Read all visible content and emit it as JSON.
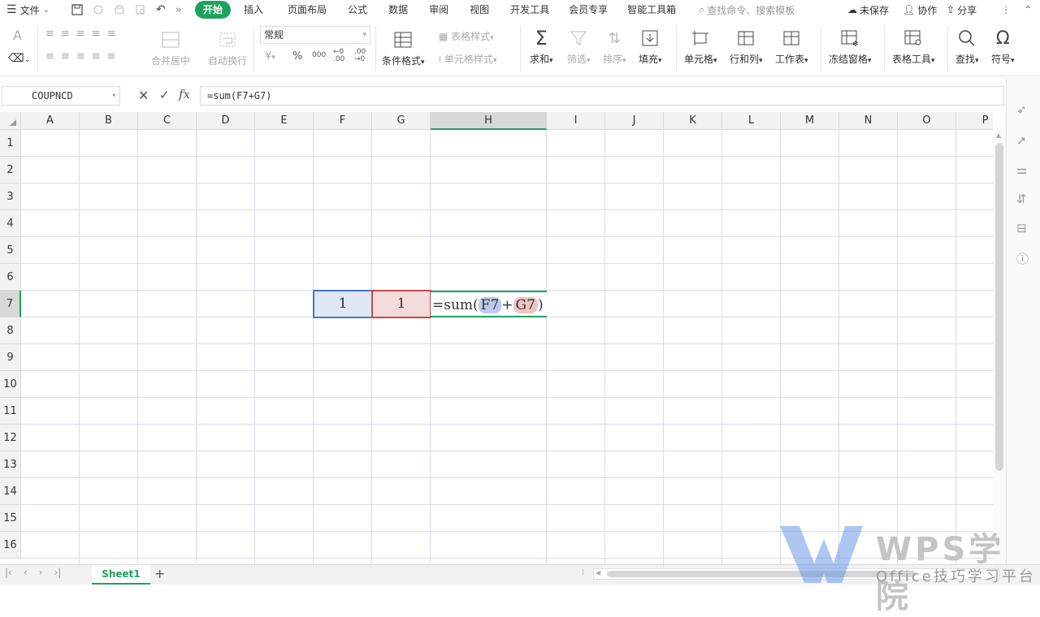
{
  "menubar": {
    "file_label": "文件",
    "tabs": [
      "开始",
      "插入",
      "页面布局",
      "公式",
      "数据",
      "审阅",
      "视图",
      "开发工具",
      "会员专享",
      "智能工具箱"
    ],
    "active_tab": "开始",
    "search_placeholder": "查找命令、搜索模板",
    "unsaved_label": "未保存",
    "collab_label": "协作",
    "share_label": "分享"
  },
  "ribbon": {
    "merge_label": "合并居中",
    "wrap_label": "自动换行",
    "number_format": "常规",
    "conditional_label": "条件格式",
    "table_style_label": "表格样式",
    "cell_style_label": "单元格样式",
    "sum_label": "求和",
    "filter_label": "筛选",
    "sort_label": "排序",
    "fill_label": "填充",
    "cell_label": "单元格",
    "rowcol_label": "行和列",
    "sheet_label": "工作表",
    "freeze_label": "冻结窗格",
    "tabletool_label": "表格工具",
    "find_label": "查找",
    "symbol_label": "符号",
    "currency_symbol": "¥",
    "percent_symbol": "%",
    "thousands_symbol": "000"
  },
  "formula_bar": {
    "name_box": "COUPNCD",
    "fx_label": "fx",
    "formula": "=sum(F7+G7)"
  },
  "grid": {
    "columns": [
      "A",
      "B",
      "C",
      "D",
      "E",
      "F",
      "G",
      "H",
      "I",
      "J",
      "K",
      "L",
      "M",
      "N",
      "O",
      "P"
    ],
    "rows": [
      "1",
      "2",
      "3",
      "4",
      "5",
      "6",
      "7",
      "8",
      "9",
      "10",
      "11",
      "12",
      "13",
      "14",
      "15",
      "16"
    ],
    "selected_column": "H",
    "selected_row": "7",
    "cells": {
      "F7": "1",
      "G7": "1"
    },
    "edit_formula": {
      "prefix": "=sum(",
      "ref1": "F7",
      "plus": "+",
      "ref2": "G7",
      "suffix": ")"
    },
    "colors": {
      "ref1_fill": "#dfe6f5",
      "ref1_border": "#4d72c6",
      "ref2_fill": "#f5dcdc",
      "ref2_border": "#c74a4a",
      "accent": "#1fa35c"
    }
  },
  "sheets": {
    "active": "Sheet1",
    "add_label": "+"
  },
  "watermark": {
    "brand": "WPS学院",
    "subtitle": "Office技巧学习平台"
  }
}
